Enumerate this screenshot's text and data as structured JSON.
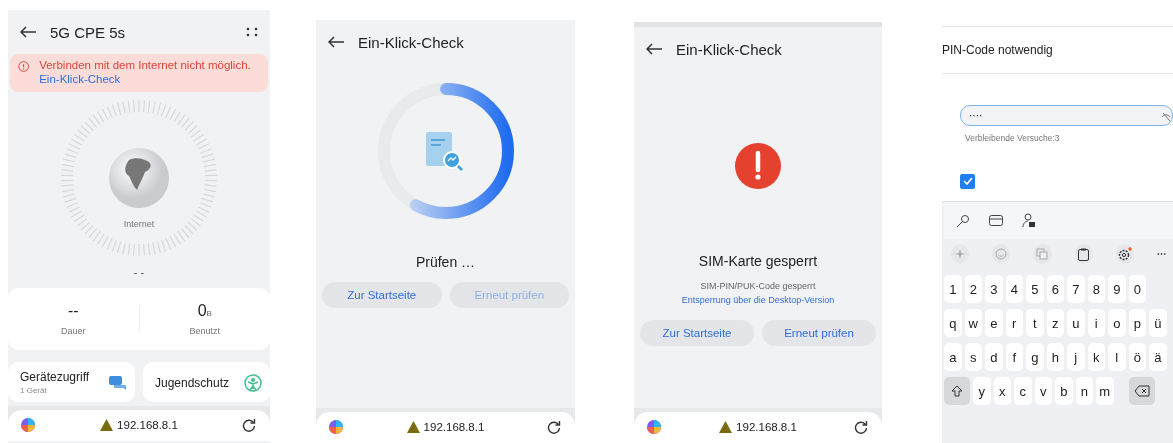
{
  "home": {
    "title": "5G CPE 5s",
    "alert_text": "Verbinden mit dem Internet nicht möglich.",
    "alert_link": "Ein-Klick-Check",
    "globe_label": "Internet",
    "speed": "- -",
    "stats": [
      {
        "value": "--",
        "label": "Dauer"
      },
      {
        "value": "0",
        "unit": "B",
        "label": "Benutzt"
      }
    ],
    "tiles": [
      {
        "kind": "devices",
        "title": "Gerätezugriff",
        "subtitle": "1 Gerät"
      },
      {
        "kind": "parental",
        "title": "Jugendschutz"
      }
    ],
    "address": "192.168.8.1"
  },
  "checking": {
    "title": "Ein-Klick-Check",
    "level": 0.58,
    "status": "Prüfen …",
    "buttons": [
      {
        "label": "Zur Startseite",
        "disabled": false
      },
      {
        "label": "Erneut prüfen",
        "disabled": true
      }
    ],
    "address": "192.168.8.1"
  },
  "result": {
    "title": "Ein-Klick-Check",
    "heading": "SIM-Karte gesperrt",
    "message": "SIM-PIN/PUK-Code gesperrt",
    "link": "Entsperrung über die Desktop-Version",
    "buttons": [
      {
        "label": "Zur Startseite",
        "disabled": false
      },
      {
        "label": "Erneut prüfen",
        "disabled": false
      }
    ],
    "address": "192.168.8.1"
  },
  "pin_dialog": {
    "title": "PIN-Code notwendig",
    "value": "····",
    "hint": "Verbleibende Versuche:3",
    "checked": true
  },
  "keyboard": {
    "rows": [
      [
        "1",
        "2",
        "3",
        "4",
        "5",
        "6",
        "7",
        "8",
        "9",
        "0"
      ],
      [
        "q",
        "w",
        "e",
        "r",
        "t",
        "z",
        "u",
        "i",
        "o",
        "p",
        "ü"
      ],
      [
        "a",
        "s",
        "d",
        "f",
        "g",
        "h",
        "j",
        "k",
        "l",
        "ö",
        "ä"
      ]
    ],
    "bottom_row": [
      "y",
      "x",
      "c",
      "v",
      "b",
      "n",
      "m"
    ]
  }
}
